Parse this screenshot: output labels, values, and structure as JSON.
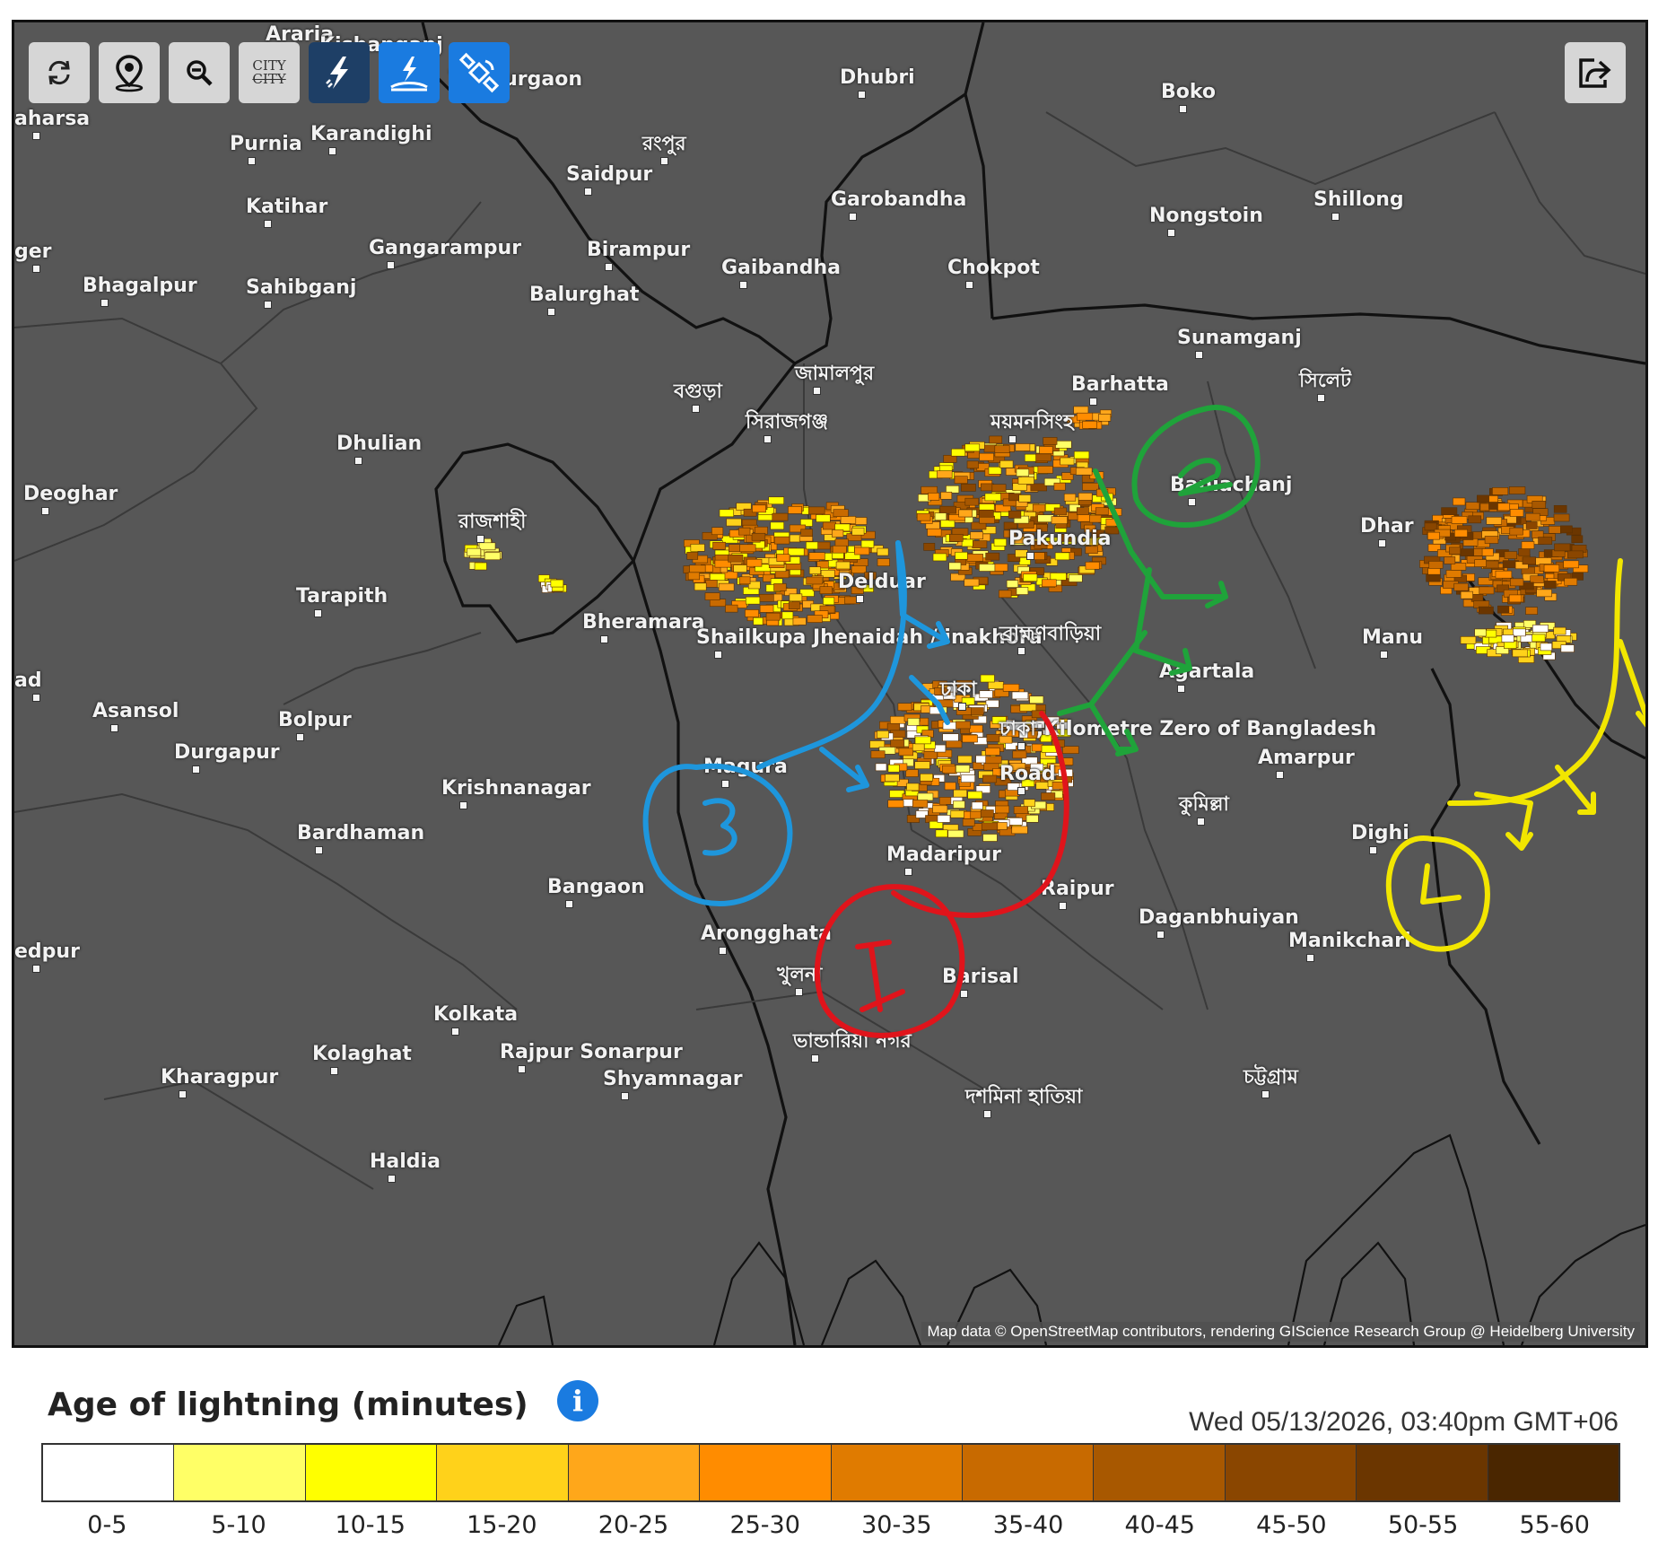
{
  "toolbar": {
    "refresh": "refresh-icon",
    "location": "location-pin-icon",
    "zoom_out": "zoom-out-icon",
    "city_label_top": "CITY",
    "city_label_bottom": "CITY",
    "lightning": "lightning-icon",
    "ground_strike": "ground-strike-icon",
    "satellite": "satellite-icon",
    "share": "share-icon"
  },
  "places": [
    {
      "name": "Araria"
    },
    {
      "name": "Kishanganj"
    },
    {
      "name": "Thakurgaon"
    },
    {
      "name": "Dhubri"
    },
    {
      "name": "Boko"
    },
    {
      "name": "aharsa"
    },
    {
      "name": "Purnia"
    },
    {
      "name": "Karandighi"
    },
    {
      "name": "রংপুর"
    },
    {
      "name": "Saidpur"
    },
    {
      "name": "Katihar"
    },
    {
      "name": "Garobandha"
    },
    {
      "name": "Shillong"
    },
    {
      "name": "Nongstoin"
    },
    {
      "name": "ger"
    },
    {
      "name": "Gangarampur"
    },
    {
      "name": "Birampur"
    },
    {
      "name": "Gaibandha"
    },
    {
      "name": "Chokpot"
    },
    {
      "name": "Bhagalpur"
    },
    {
      "name": "Sahibganj"
    },
    {
      "name": "Balurghat"
    },
    {
      "name": "Sunamganj"
    },
    {
      "name": "জামালপুর"
    },
    {
      "name": "Barhatta"
    },
    {
      "name": "সিলেট"
    },
    {
      "name": "বগুড়া"
    },
    {
      "name": "সিরাজগঞ্জ"
    },
    {
      "name": "ময়মনসিংহ"
    },
    {
      "name": "Dhulian"
    },
    {
      "name": "Baniachanj"
    },
    {
      "name": "Deoghar"
    },
    {
      "name": "রাজশাহী"
    },
    {
      "name": "Pakundia"
    },
    {
      "name": "Dhar"
    },
    {
      "name": "Tarapith"
    },
    {
      "name": "Delduar"
    },
    {
      "name": "Bheramara"
    },
    {
      "name": "Shailkupa Jhenaidah / inakhora"
    },
    {
      "name": "ব্রাহ্মণবাড়িয়া"
    },
    {
      "name": "Manu"
    },
    {
      "name": "ad"
    },
    {
      "name": "Agartala"
    },
    {
      "name": "ঢাকা"
    },
    {
      "name": "Asansol"
    },
    {
      "name": "Bolpur"
    },
    {
      "name": "ঢাকা;Kilometre Zero of Bangladesh"
    },
    {
      "name": "Road"
    },
    {
      "name": "Durgapur"
    },
    {
      "name": "Amarpur"
    },
    {
      "name": "Magura"
    },
    {
      "name": "Krishnanagar"
    },
    {
      "name": "কুমিল্লা"
    },
    {
      "name": "Bardhaman"
    },
    {
      "name": "Dighi"
    },
    {
      "name": "Madaripur"
    },
    {
      "name": "Bangaon"
    },
    {
      "name": "Raipur"
    },
    {
      "name": "Daganbhuiyan"
    },
    {
      "name": "edpur"
    },
    {
      "name": "Manikchari"
    },
    {
      "name": "Arongghata"
    },
    {
      "name": "খুলনা"
    },
    {
      "name": "Barisal"
    },
    {
      "name": "Kolkata"
    },
    {
      "name": "Kolaghat"
    },
    {
      "name": "Rajpur Sonarpur"
    },
    {
      "name": "ভান্ডারিয়া নগর"
    },
    {
      "name": "Shyamnagar"
    },
    {
      "name": "Kharagpur"
    },
    {
      "name": "চট্টগ্রাম"
    },
    {
      "name": "দশমিনা হাতিয়া"
    },
    {
      "name": "Haldia"
    }
  ],
  "attribution": "Map data © OpenStreetMap contributors, rendering GIScience Research Group @ Heidelberg University",
  "annotations": [
    {
      "label": "1",
      "color": "#e0141b"
    },
    {
      "label": "2",
      "color": "#1fa33a"
    },
    {
      "label": "3",
      "color": "#1e96dc"
    },
    {
      "label": "4",
      "color": "#f2e600"
    }
  ],
  "legend": {
    "title": "Age of lightning (minutes)",
    "info": "i",
    "timestamp": "Wed 05/13/2026, 03:40pm GMT+06",
    "bins": [
      {
        "label": "0-5",
        "color": "#ffffff"
      },
      {
        "label": "5-10",
        "color": "#ffff66"
      },
      {
        "label": "10-15",
        "color": "#ffff00"
      },
      {
        "label": "15-20",
        "color": "#ffd21a"
      },
      {
        "label": "20-25",
        "color": "#ffa71a"
      },
      {
        "label": "25-30",
        "color": "#ff8c00"
      },
      {
        "label": "30-35",
        "color": "#e07b00"
      },
      {
        "label": "35-40",
        "color": "#c86a00"
      },
      {
        "label": "40-45",
        "color": "#a85800"
      },
      {
        "label": "45-50",
        "color": "#8a4600"
      },
      {
        "label": "50-55",
        "color": "#6b3600"
      },
      {
        "label": "55-60",
        "color": "#4a2600"
      }
    ]
  }
}
